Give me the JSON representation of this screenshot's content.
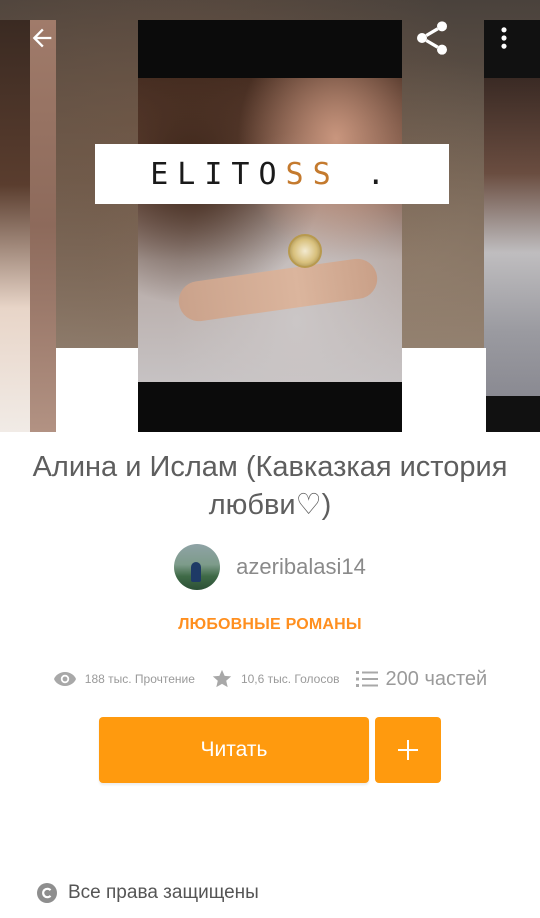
{
  "cover": {
    "title_text_main": "ELITO",
    "title_text_accent": "SS",
    "title_text_tail": "."
  },
  "toolbar": {
    "back_icon": "arrow-left-icon",
    "share_icon": "share-icon",
    "more_icon": "more-vertical-icon"
  },
  "story": {
    "title": "Алина и Ислам (Кавказкая история любви♡)",
    "author": "azeribalasi14",
    "genre": "ЛЮБОВНЫЕ РОМАНЫ"
  },
  "stats": {
    "reads": "188 тыс. Прочтение",
    "votes": "10,6 тыс. Голосов",
    "parts": "200 частей"
  },
  "buttons": {
    "read_label": "Читать",
    "add_label": "+"
  },
  "footer": {
    "rights": "Все права защищены"
  },
  "colors": {
    "accent": "#ff9a0e",
    "genre": "#ff8f1f"
  }
}
